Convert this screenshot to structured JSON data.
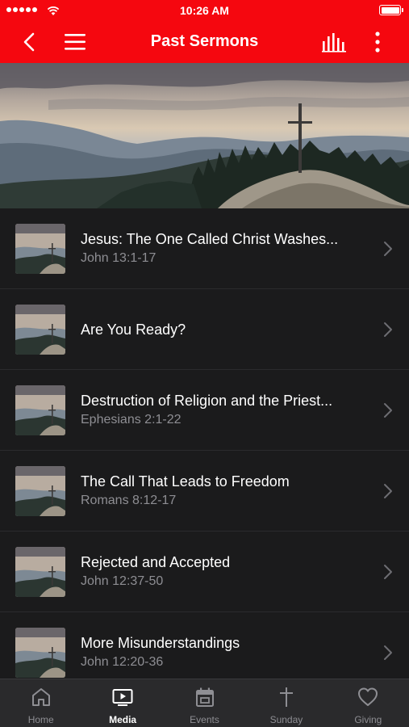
{
  "status_bar": {
    "time": "10:26 AM"
  },
  "nav": {
    "title": "Past Sermons"
  },
  "sermons": [
    {
      "title": "Jesus: The One Called Christ Washes...",
      "scripture": "John 13:1-17"
    },
    {
      "title": "Are You Ready?",
      "scripture": ""
    },
    {
      "title": "Destruction of Religion and the Priest...",
      "scripture": "Ephesians 2:1-22"
    },
    {
      "title": "The Call That Leads to Freedom",
      "scripture": "Romans 8:12-17"
    },
    {
      "title": "Rejected and Accepted",
      "scripture": "John 12:37-50"
    },
    {
      "title": "More Misunderstandings",
      "scripture": "John 12:20-36"
    }
  ],
  "tabs": [
    {
      "label": "Home",
      "icon": "home-icon",
      "active": false
    },
    {
      "label": "Media",
      "icon": "tv-play-icon",
      "active": true
    },
    {
      "label": "Events",
      "icon": "calendar-icon",
      "active": false
    },
    {
      "label": "Sunday",
      "icon": "cross-icon",
      "active": false
    },
    {
      "label": "Giving",
      "icon": "heart-icon",
      "active": false
    }
  ],
  "colors": {
    "header_red": "#f5070f",
    "background": "#1b1b1c",
    "tabbar": "#2a2a2c",
    "secondary_text": "#8e8e93"
  }
}
